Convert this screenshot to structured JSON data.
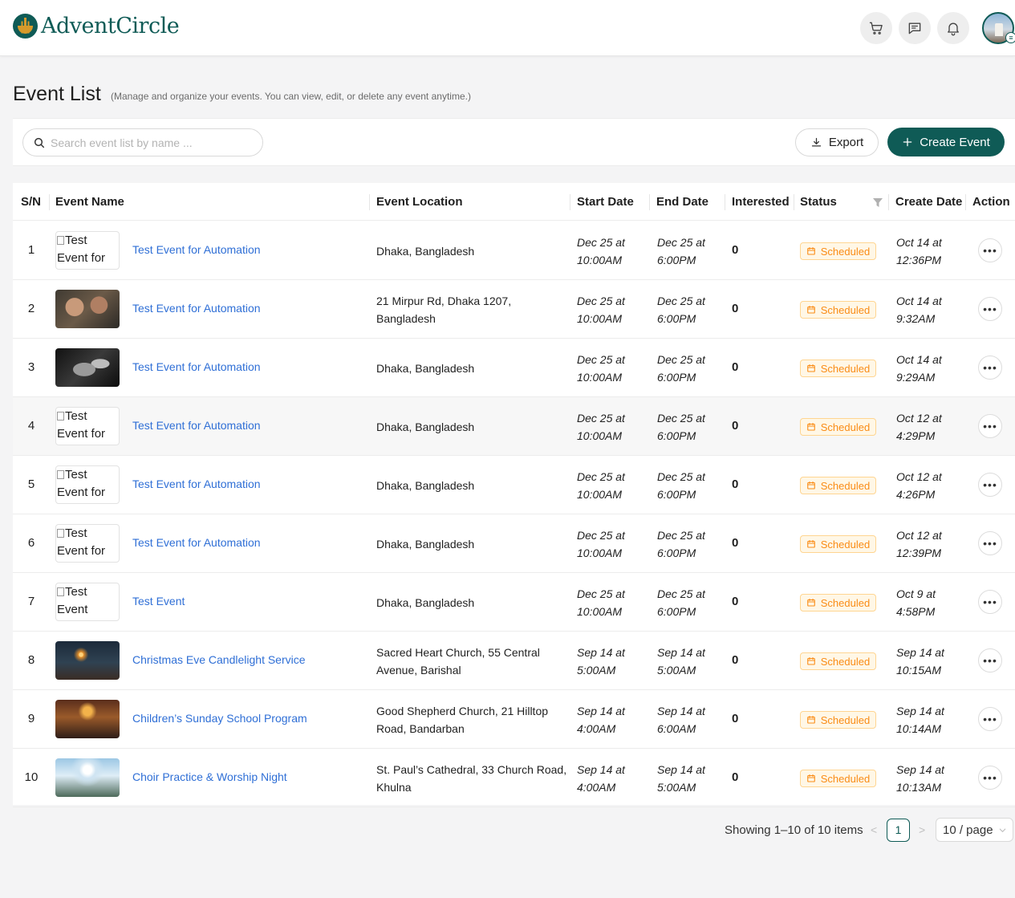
{
  "app": {
    "name": "AdventCircle"
  },
  "header": {
    "icons": [
      "cart-icon",
      "chat-icon",
      "bell-icon"
    ],
    "avatar_menu_glyph": "≡"
  },
  "page": {
    "title": "Event List",
    "subtitle": "(Manage and organize your events. You can view, edit, or delete any event anytime.)"
  },
  "toolbar": {
    "search_placeholder": "Search event list by name ...",
    "export_label": "Export",
    "create_label": "Create Event"
  },
  "table": {
    "columns": {
      "sn": "S/N",
      "name": "Event Name",
      "location": "Event Location",
      "start": "Start Date",
      "end": "End Date",
      "interested": "Interested",
      "status": "Status",
      "created": "Create Date",
      "action": "Action"
    },
    "rows": [
      {
        "sn": "1",
        "alt": "Test Event for",
        "image": "broken",
        "name": "Test Event for Automation",
        "loc1": "Dhaka, Bangladesh",
        "loc2": "",
        "start1": "Dec 25 at",
        "start2": "10:00AM",
        "end1": "Dec 25 at",
        "end2": "6:00PM",
        "interested": "0",
        "status": "Scheduled",
        "created1": "Oct 14 at",
        "created2": "12:36PM"
      },
      {
        "sn": "2",
        "alt": "",
        "image": "children-photo",
        "name": "Test Event for Automation",
        "loc1": "21 Mirpur Rd, Dhaka 1207,",
        "loc2": "Bangladesh",
        "start1": "Dec 25 at",
        "start2": "10:00AM",
        "end1": "Dec 25 at",
        "end2": "6:00PM",
        "interested": "0",
        "status": "Scheduled",
        "created1": "Oct 14 at",
        "created2": "9:32AM"
      },
      {
        "sn": "3",
        "alt": "",
        "image": "hands-photo",
        "name": "Test Event for Automation",
        "loc1": "Dhaka, Bangladesh",
        "loc2": "",
        "start1": "Dec 25 at",
        "start2": "10:00AM",
        "end1": "Dec 25 at",
        "end2": "6:00PM",
        "interested": "0",
        "status": "Scheduled",
        "created1": "Oct 14 at",
        "created2": "9:29AM"
      },
      {
        "sn": "4",
        "alt": "Test Event for",
        "image": "broken",
        "name": "Test Event for Automation",
        "loc1": "Dhaka, Bangladesh",
        "loc2": "",
        "start1": "Dec 25 at",
        "start2": "10:00AM",
        "end1": "Dec 25 at",
        "end2": "6:00PM",
        "interested": "0",
        "status": "Scheduled",
        "created1": "Oct 12 at",
        "created2": "4:29PM"
      },
      {
        "sn": "5",
        "alt": "Test Event for",
        "image": "broken",
        "name": "Test Event for Automation",
        "loc1": "Dhaka, Bangladesh",
        "loc2": "",
        "start1": "Dec 25 at",
        "start2": "10:00AM",
        "end1": "Dec 25 at",
        "end2": "6:00PM",
        "interested": "0",
        "status": "Scheduled",
        "created1": "Oct 12 at",
        "created2": "4:26PM"
      },
      {
        "sn": "6",
        "alt": "Test Event for",
        "image": "broken",
        "name": "Test Event for Automation",
        "loc1": "Dhaka, Bangladesh",
        "loc2": "",
        "start1": "Dec 25 at",
        "start2": "10:00AM",
        "end1": "Dec 25 at",
        "end2": "6:00PM",
        "interested": "0",
        "status": "Scheduled",
        "created1": "Oct 12 at",
        "created2": "12:39PM"
      },
      {
        "sn": "7",
        "alt": "Test Event",
        "image": "broken",
        "name": "Test Event",
        "loc1": "Dhaka, Bangladesh",
        "loc2": "",
        "start1": "Dec 25 at",
        "start2": "10:00AM",
        "end1": "Dec 25 at",
        "end2": "6:00PM",
        "interested": "0",
        "status": "Scheduled",
        "created1": "Oct 9 at",
        "created2": "4:58PM"
      },
      {
        "sn": "8",
        "alt": "",
        "image": "candle-photo",
        "name": "Christmas Eve Candlelight Service",
        "loc1": "Sacred Heart Church, 55 Central",
        "loc2": "Avenue, Barishal",
        "start1": "Sep 14 at",
        "start2": "5:00AM",
        "end1": "Sep 14 at",
        "end2": "5:00AM",
        "interested": "0",
        "status": "Scheduled",
        "created1": "Sep 14 at",
        "created2": "10:15AM"
      },
      {
        "sn": "9",
        "alt": "",
        "image": "church-photo",
        "name": "Children’s Sunday School Program",
        "loc1": "Good Shepherd Church, 21 Hilltop",
        "loc2": "Road, Bandarban",
        "start1": "Sep 14 at",
        "start2": "4:00AM",
        "end1": "Sep 14 at",
        "end2": "6:00AM",
        "interested": "0",
        "status": "Scheduled",
        "created1": "Sep 14 at",
        "created2": "10:14AM"
      },
      {
        "sn": "10",
        "alt": "",
        "image": "worship-photo",
        "name": "Choir Practice & Worship Night",
        "loc1": "St. Paul’s Cathedral, 33 Church Road,",
        "loc2": "Khulna",
        "start1": "Sep 14 at",
        "start2": "4:00AM",
        "end1": "Sep 14 at",
        "end2": "5:00AM",
        "interested": "0",
        "status": "Scheduled",
        "created1": "Sep 14 at",
        "created2": "10:13AM"
      }
    ]
  },
  "pagination": {
    "summary": "Showing 1–10 of 10 items",
    "prev": "<",
    "current": "1",
    "next": ">",
    "page_size": "10 / page"
  },
  "colors": {
    "brand": "#0f5b56",
    "link": "#2f6fd6",
    "status_scheduled": "#fa8c16"
  }
}
